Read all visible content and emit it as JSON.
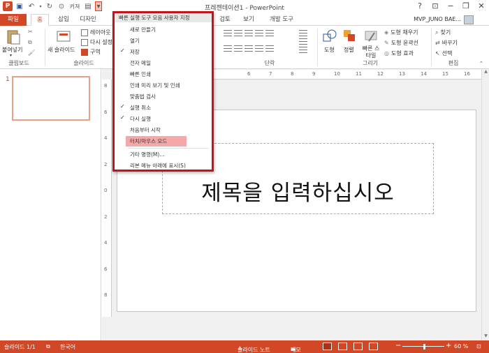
{
  "window": {
    "title": "프레젠테이션1 - PowerPoint",
    "account": "MVP_JUNO BAE..."
  },
  "qat": {
    "touch_label": "커져"
  },
  "tabs": [
    {
      "label": "파일"
    },
    {
      "label": "홈"
    },
    {
      "label": "삽입"
    },
    {
      "label": "디자인"
    },
    {
      "label": "검토"
    },
    {
      "label": "보기"
    },
    {
      "label": "개발 도구"
    }
  ],
  "ribbon": {
    "clipboard": {
      "paste": "붙여넣기",
      "label": "클립보드"
    },
    "slides": {
      "layout": "레이아웃",
      "new_slide": "새 슬라이드",
      "reset": "다시 설정",
      "section": "구역",
      "label": "슬라이드"
    },
    "paragraph": {
      "label": "단락"
    },
    "drawing": {
      "shape": "도형",
      "arrange": "정렬",
      "quick_style": "빠른 스타일",
      "fill": "도형 채우기",
      "outline": "도형 윤곽선",
      "effect": "도형 효과",
      "label": "그리기"
    },
    "editing": {
      "find": "찾기",
      "replace": "바꾸기",
      "select": "선택",
      "label": "편집"
    }
  },
  "dropdown": {
    "header": "빠른 실행 도구 모음 사용자 지정",
    "items": [
      {
        "label": "새로 만들기",
        "checked": false
      },
      {
        "label": "열기",
        "checked": false
      },
      {
        "label": "저장",
        "checked": true
      },
      {
        "label": "전자 메일",
        "checked": false
      },
      {
        "label": "빠른 인쇄",
        "checked": false
      },
      {
        "label": "인쇄 미리 보기 및 인쇄",
        "checked": false
      },
      {
        "label": "맞춤법 검사",
        "checked": false
      },
      {
        "label": "실행 취소",
        "checked": true
      },
      {
        "label": "다시 실행",
        "checked": true
      },
      {
        "label": "처음부터 시작",
        "checked": false
      },
      {
        "label": "터치/마우스 모드",
        "checked": false,
        "highlight": true
      },
      {
        "label": "기타 명령(M)...",
        "checked": false
      },
      {
        "label": "리본 메뉴 아래에 표시(S)",
        "checked": false
      }
    ]
  },
  "slide_panel": {
    "thumb_number": "1"
  },
  "slide": {
    "title_placeholder": "제목을 입력하십시오"
  },
  "ruler": {
    "h_numbers": [
      "6",
      "7",
      "8",
      "9",
      "10",
      "11",
      "12",
      "13",
      "14",
      "15",
      "16"
    ],
    "v_numbers": [
      "8",
      "6",
      "4",
      "2",
      "0",
      "2",
      "4",
      "6",
      "8"
    ]
  },
  "status": {
    "slide_info": "슬라이드 1/1",
    "language": "한국어",
    "notes": "슬라이드 노트",
    "comments": "메모",
    "zoom": "60 %"
  },
  "colors": {
    "accent": "#d24726",
    "highlight_border": "#c0151a",
    "highlight_fill": "#f4a9a8"
  }
}
